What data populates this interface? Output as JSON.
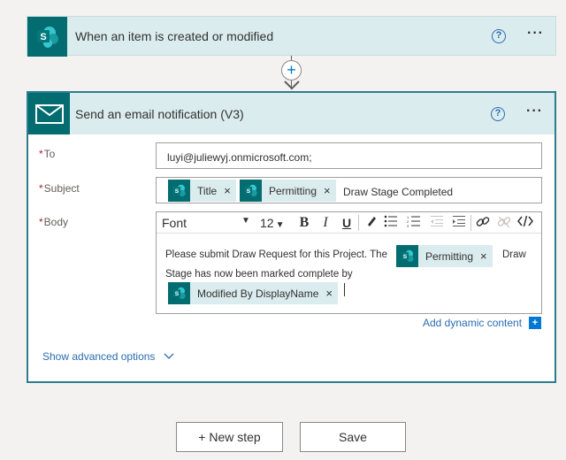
{
  "trigger": {
    "title": "When an item is created or modified",
    "help": "?",
    "more": "···"
  },
  "connector": {
    "add_symbol": "+"
  },
  "action": {
    "title": "Send an email notification (V3)",
    "help": "?",
    "more": "···",
    "fields": {
      "to": {
        "label": "To",
        "required_mark": "*",
        "value": "luyi@juliewyj.onmicrosoft.com;"
      },
      "subject": {
        "label": "Subject",
        "required_mark": "*",
        "tokens": [
          {
            "label": "Title",
            "remove": "×"
          },
          {
            "label": "Permitting",
            "remove": "×"
          }
        ],
        "text": "Draw Stage Completed"
      },
      "body": {
        "label": "Body",
        "required_mark": "*",
        "toolbar": {
          "font": "Font",
          "size": "12",
          "bold": "B",
          "italic": "I",
          "underline": "U"
        },
        "text_line1": "Please submit Draw Request for this Project. The",
        "token_permitting": "Permitting",
        "text_after_token": "Draw",
        "text_line2": "Stage has now been marked complete by",
        "token_modified_by": "Modified By DisplayName",
        "remove": "×"
      }
    },
    "add_dynamic_content": "Add dynamic content",
    "add_dynamic_plus": "+",
    "show_advanced": "Show advanced options"
  },
  "buttons": {
    "new_step": "+ New step",
    "save": "Save"
  },
  "colors": {
    "sharepoint": "#036c70",
    "header_bg": "#dbecee",
    "link": "#2b6cb0",
    "accent": "#0078d4"
  }
}
